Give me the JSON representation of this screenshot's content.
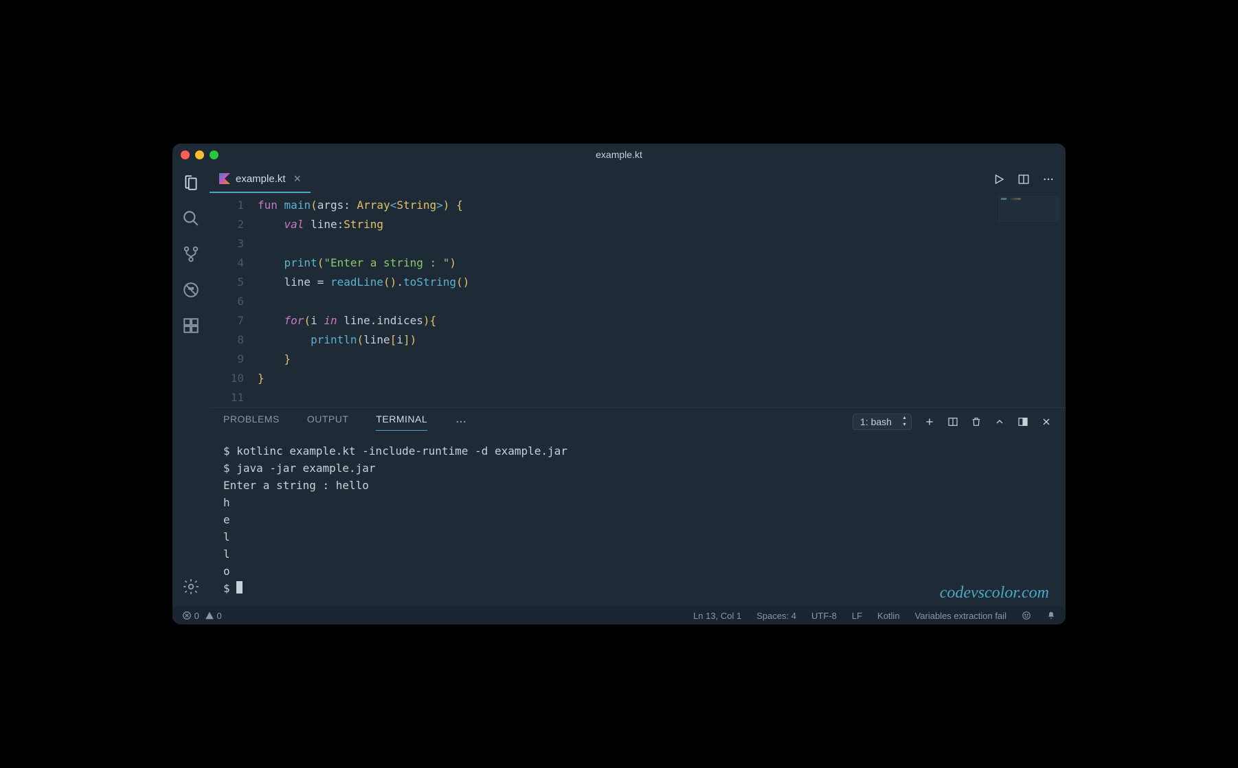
{
  "window": {
    "title": "example.kt"
  },
  "tab": {
    "filename": "example.kt"
  },
  "code": {
    "lines": [
      {
        "n": "1"
      },
      {
        "n": "2"
      },
      {
        "n": "3"
      },
      {
        "n": "4"
      },
      {
        "n": "5"
      },
      {
        "n": "6"
      },
      {
        "n": "7"
      },
      {
        "n": "8"
      },
      {
        "n": "9"
      },
      {
        "n": "10"
      },
      {
        "n": "11"
      }
    ],
    "tokens": {
      "l1": {
        "fun": "fun",
        "main": "main",
        "args": "args",
        "array": "Array",
        "string": "String"
      },
      "l2": {
        "val": "val",
        "line": "line",
        "type": "String"
      },
      "l4": {
        "print": "print",
        "str": "\"Enter a string : \""
      },
      "l5": {
        "line": "line",
        "readLine": "readLine",
        "toString": "toString"
      },
      "l7": {
        "for": "for",
        "i": "i",
        "in": "in",
        "line": "line",
        "indices": "indices"
      },
      "l8": {
        "println": "println",
        "line": "line",
        "i": "i"
      }
    }
  },
  "panel": {
    "tabs": {
      "problems": "PROBLEMS",
      "output": "OUTPUT",
      "terminal": "TERMINAL"
    },
    "terminal_selector": "1: bash",
    "terminal_lines": [
      "$ kotlinc example.kt -include-runtime -d example.jar",
      "$ java -jar example.jar",
      "Enter a string : hello",
      "h",
      "e",
      "l",
      "l",
      "o",
      "$ "
    ]
  },
  "status": {
    "errors": "0",
    "warnings": "0",
    "cursor": "Ln 13, Col 1",
    "spaces": "Spaces: 4",
    "encoding": "UTF-8",
    "eol": "LF",
    "language": "Kotlin",
    "note": "Variables extraction fail"
  },
  "watermark": "codevscolor.com"
}
